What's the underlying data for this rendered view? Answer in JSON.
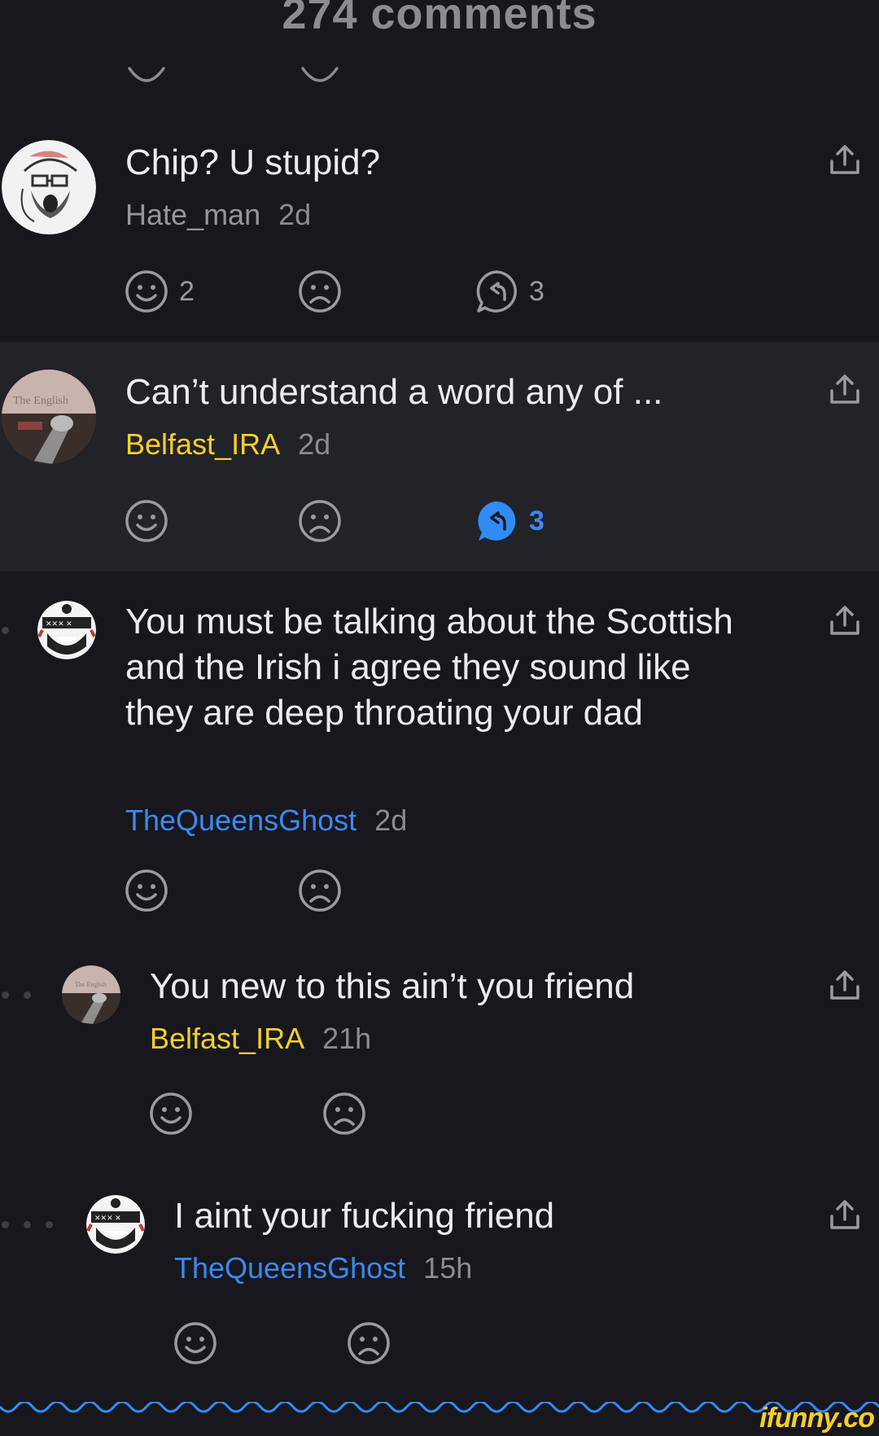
{
  "header": {
    "title": "274 comments"
  },
  "comments": [
    {
      "text": "Chip? U stupid?",
      "author": "Hate_man",
      "time": "2d",
      "smile_count": "2",
      "reply_count": "3"
    },
    {
      "text": "Can’t understand a word any of ...",
      "author": "Belfast_IRA",
      "time": "2d",
      "reply_count": "3",
      "avatar_caption": "The English"
    },
    {
      "text": "You must be talking about the Scottish and the Irish i agree they sound like they are deep throating your dad",
      "author": "TheQueensGhost",
      "time": "2d"
    },
    {
      "text": "You new to this ain’t you friend",
      "author": "Belfast_IRA",
      "time": "21h",
      "avatar_caption": "The English"
    },
    {
      "text": "I aint your fucking friend",
      "author": "TheQueensGhost",
      "time": "15h"
    }
  ],
  "watermark": "ifunny.co",
  "colors": {
    "background": "#17171d",
    "highlight": "#222229",
    "yellow_author": "#f6d028",
    "blue_author": "#3d88f0",
    "active_reply": "#2f8cf6"
  },
  "icons": [
    "smile-icon",
    "frown-icon",
    "reply-icon",
    "share-icon"
  ]
}
